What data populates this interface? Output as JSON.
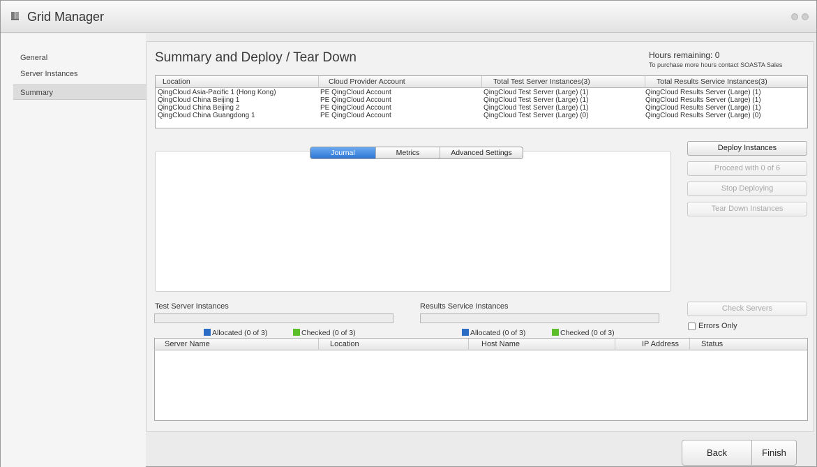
{
  "window": {
    "title": "Grid Manager",
    "icon": "grid-icon"
  },
  "sidebar": {
    "items": [
      {
        "label": "General",
        "selected": false
      },
      {
        "label": "Server Instances",
        "selected": false
      },
      {
        "label": "Summary",
        "selected": true
      }
    ]
  },
  "main": {
    "title": "Summary and Deploy / Tear Down",
    "hours_remaining": "Hours remaining: 0",
    "hours_note": "To purchase more hours contact SOASTA Sales"
  },
  "locations_table": {
    "columns": [
      "Location",
      "Cloud Provider Account",
      "Total Test Server Instances(3)",
      "Total Results Service Instances(3)"
    ],
    "rows": [
      [
        "QingCloud Asia-Pacific 1 (Hong Kong)",
        "PE QingCloud Account",
        "QingCloud Test Server (Large) (1)",
        "QingCloud Results Server (Large) (1)"
      ],
      [
        "QingCloud China Beijing 1",
        "PE QingCloud Account",
        "QingCloud Test Server (Large) (1)",
        "QingCloud Results Server (Large) (1)"
      ],
      [
        "QingCloud China Beijing 2",
        "PE QingCloud Account",
        "QingCloud Test Server (Large) (1)",
        "QingCloud Results Server (Large) (1)"
      ],
      [
        "QingCloud China Guangdong 1",
        "PE QingCloud Account",
        "QingCloud Test Server (Large) (0)",
        "QingCloud Results Server (Large) (0)"
      ]
    ]
  },
  "tabs": [
    {
      "label": "Journal",
      "active": true
    },
    {
      "label": "Metrics",
      "active": false
    },
    {
      "label": "Advanced Settings",
      "active": false
    }
  ],
  "actions": {
    "deploy": "Deploy Instances",
    "proceed": "Proceed with 0 of 6",
    "stop": "Stop Deploying",
    "tear_down": "Tear Down Instances",
    "check_servers": "Check Servers",
    "errors_only": "Errors Only"
  },
  "progress": {
    "test_label": "Test Server Instances",
    "results_label": "Results Service Instances",
    "test_allocated": "Allocated (0 of 3)",
    "test_checked": "Checked (0 of 3)",
    "results_allocated": "Allocated (0 of 3)",
    "results_checked": "Checked (0 of 3)",
    "test_fraction": 0,
    "results_fraction": 0,
    "allocated_color": "#2b6cc4",
    "checked_color": "#5cbf2a"
  },
  "servers_table": {
    "columns": [
      "Server Name",
      "Location",
      "Host Name",
      "IP Address",
      "Status"
    ],
    "rows": []
  },
  "footer": {
    "back": "Back",
    "finish": "Finish"
  }
}
